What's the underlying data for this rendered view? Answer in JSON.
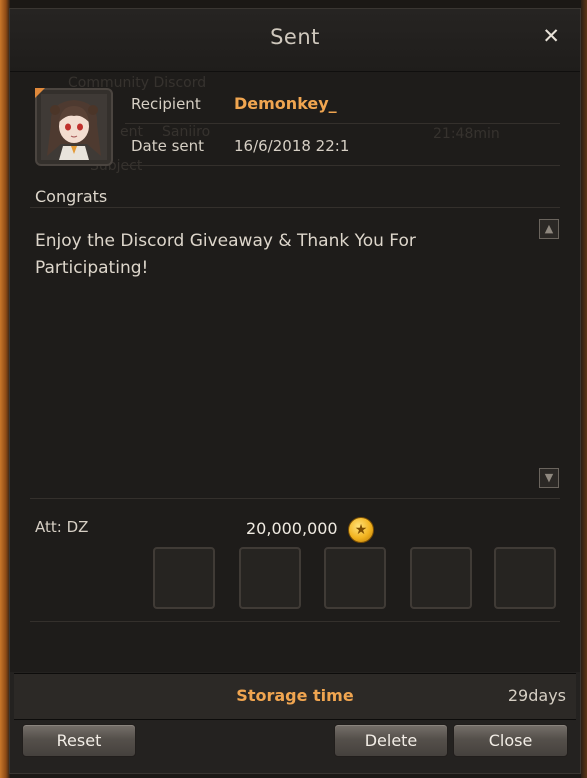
{
  "window": {
    "title": "Sent",
    "close_icon": "close-icon"
  },
  "background_ghost": {
    "text1": "Community Discord",
    "text2": "Saniiro",
    "text3": "21:48min",
    "text4": "ent",
    "text5": "Subject"
  },
  "mail": {
    "recipient_label": "Recipient",
    "recipient_name": "Demonkey_",
    "date_label": "Date sent",
    "date_value": "16/6/2018 22:1",
    "subject": "Congrats",
    "body": "Enjoy the Discord Giveaway & Thank You For Participating!"
  },
  "attachment": {
    "label": "Att: DZ",
    "gold_amount": "20,000,000",
    "coin_icon": "gold-coin-icon",
    "slot_count": 5
  },
  "storage": {
    "label": "Storage time",
    "value": "29days"
  },
  "buttons": {
    "reset": "Reset",
    "delete": "Delete",
    "close": "Close"
  },
  "colors": {
    "accent_orange": "#f0a550",
    "panel_bg": "#242220"
  }
}
